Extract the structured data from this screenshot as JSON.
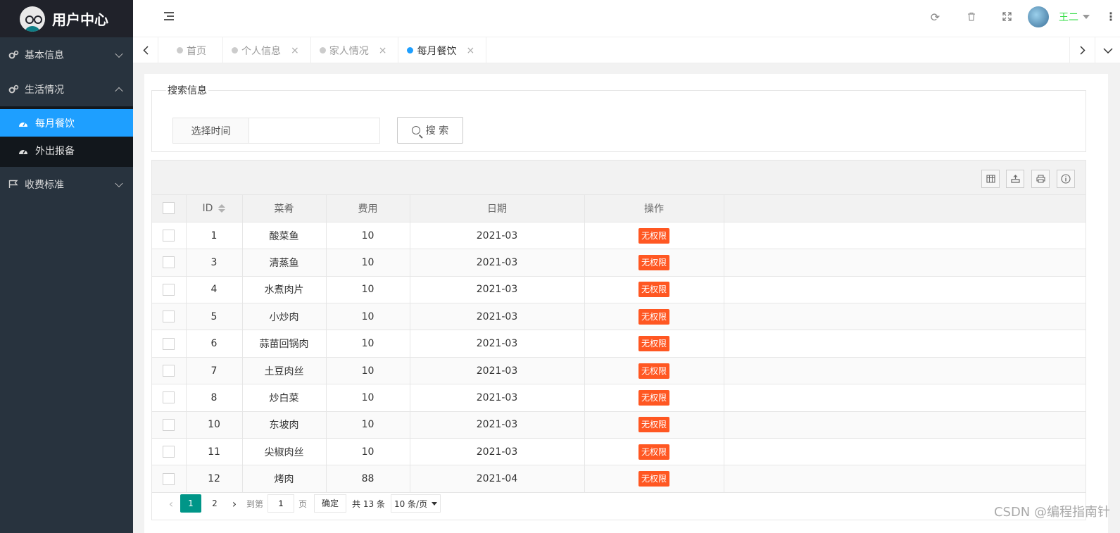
{
  "app": {
    "title": "用户中心"
  },
  "sidebar": {
    "items": [
      {
        "label": "基本信息",
        "expanded": false
      },
      {
        "label": "生活情况",
        "expanded": true,
        "children": [
          {
            "label": "每月餐饮",
            "active": true
          },
          {
            "label": "外出报备",
            "active": false
          }
        ]
      },
      {
        "label": "收费标准",
        "expanded": false
      }
    ]
  },
  "header": {
    "user_name": "王二"
  },
  "tabs": [
    {
      "label": "首页",
      "active": false
    },
    {
      "label": "个人信息",
      "active": false
    },
    {
      "label": "家人情况",
      "active": false
    },
    {
      "label": "每月餐饮",
      "active": true
    }
  ],
  "search": {
    "legend": "搜索信息",
    "label": "选择时间",
    "value": "",
    "button": "搜 索"
  },
  "table": {
    "columns": [
      "ID",
      "菜肴",
      "费用",
      "日期",
      "操作"
    ],
    "rows": [
      {
        "id": "1",
        "dish": "酸菜鱼",
        "cost": "10",
        "date": "2021-03",
        "action": "无权限"
      },
      {
        "id": "3",
        "dish": "清蒸鱼",
        "cost": "10",
        "date": "2021-03",
        "action": "无权限"
      },
      {
        "id": "4",
        "dish": "水煮肉片",
        "cost": "10",
        "date": "2021-03",
        "action": "无权限"
      },
      {
        "id": "5",
        "dish": "小炒肉",
        "cost": "10",
        "date": "2021-03",
        "action": "无权限"
      },
      {
        "id": "6",
        "dish": "蒜苗回锅肉",
        "cost": "10",
        "date": "2021-03",
        "action": "无权限"
      },
      {
        "id": "7",
        "dish": "土豆肉丝",
        "cost": "10",
        "date": "2021-03",
        "action": "无权限"
      },
      {
        "id": "8",
        "dish": "炒白菜",
        "cost": "10",
        "date": "2021-03",
        "action": "无权限"
      },
      {
        "id": "10",
        "dish": "东坡肉",
        "cost": "10",
        "date": "2021-03",
        "action": "无权限"
      },
      {
        "id": "11",
        "dish": "尖椒肉丝",
        "cost": "10",
        "date": "2021-03",
        "action": "无权限"
      },
      {
        "id": "12",
        "dish": "烤肉",
        "cost": "88",
        "date": "2021-04",
        "action": "无权限"
      }
    ]
  },
  "pager": {
    "pages": [
      "1",
      "2"
    ],
    "current": "1",
    "goto_label": "到第",
    "page_input": "1",
    "page_unit": "页",
    "confirm": "确定",
    "total": "共 13 条",
    "per_page": "10 条/页"
  },
  "watermark": "CSDN @编程指南针",
  "colors": {
    "accent": "#1e9fff",
    "sidebar": "#28333e",
    "badge": "#ff5722",
    "pager_current": "#009688",
    "user_name": "#33dd44"
  }
}
